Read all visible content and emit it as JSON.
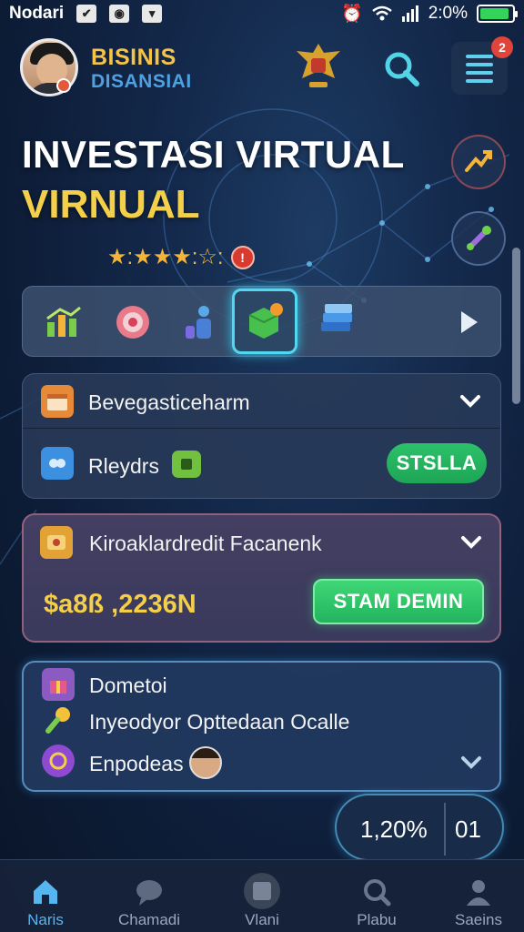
{
  "status_bar": {
    "carrier": "Nodari",
    "icons": [
      "app-icon-1",
      "app-icon-2",
      "app-icon-3"
    ],
    "battery_percent": "2:0%",
    "battery_level": 0.9,
    "battery_color": "#34d35a"
  },
  "header": {
    "brand_line1": "BISINIS",
    "brand_line2": "DISANSIAI",
    "menu_badge": "2"
  },
  "hero": {
    "title": "INVESTASI VIRTUAL",
    "subtitle": "VIRNUAL",
    "rating_stars": "★:★★★:☆:",
    "rating_badge": "!"
  },
  "categories": {
    "items": [
      "chart-icon",
      "target-icon",
      "people-icon",
      "box-icon",
      "stack-icon"
    ],
    "active_index": 3
  },
  "card1": {
    "row1_label": "Bevegasticeharm",
    "row2_label": "Rleydrs",
    "row2_button": "STSLLA"
  },
  "card2": {
    "title": "Kiroaklardredit Facanenk",
    "amount": "$a8ß ,2236N",
    "button": "STAM DEMIN"
  },
  "card3": {
    "row1_label": "Dometoi",
    "row2_label": "Inyeodyor  Opttedaan Ocalle",
    "row3_label": "Enpodeas"
  },
  "progress": {
    "percent": "1,20%",
    "timer": "01"
  },
  "bottom_nav": {
    "items": [
      {
        "label": "Naris",
        "icon": "home-icon"
      },
      {
        "label": "Chamadi",
        "icon": "chat-icon"
      },
      {
        "label": "Vlani",
        "icon": "center-icon"
      },
      {
        "label": "Plabu",
        "icon": "search-icon"
      },
      {
        "label": "Saeins",
        "icon": "person-icon"
      }
    ],
    "active_index": 0
  },
  "colors": {
    "accent_gold": "#f3cf4a",
    "accent_cyan": "#52d7f0",
    "button_green": "#22b45e",
    "badge_red": "#e0443a"
  }
}
